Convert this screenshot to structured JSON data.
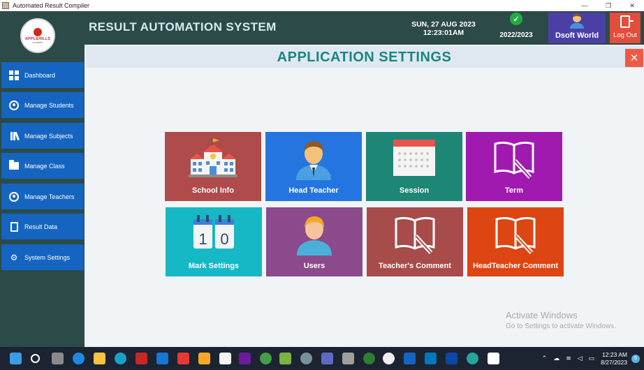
{
  "window": {
    "title": "Automated Result Compiler",
    "minimize": "—",
    "restore": "❐",
    "close": "✕"
  },
  "header": {
    "app_title": "RESULT AUTOMATION SYSTEM",
    "date": "SUN, 27 AUG 2023",
    "time": "12:23:01AM",
    "session": "2022/2023",
    "user": "Dsoft World",
    "logout": "Log Out",
    "logo_name": "APPLEHILLS",
    "logo_sub": "ACADEMY"
  },
  "sidebar": {
    "items": [
      {
        "label": "Dashboard",
        "icon": "dashboard-icon"
      },
      {
        "label": "Manage Students",
        "icon": "student-icon"
      },
      {
        "label": "Manage Subjects",
        "icon": "books-icon"
      },
      {
        "label": "Manage Class",
        "icon": "folder-icon"
      },
      {
        "label": "Manage Teachers",
        "icon": "teacher-icon"
      },
      {
        "label": "Result Data",
        "icon": "document-icon"
      },
      {
        "label": "System Settings",
        "icon": "gear-icon"
      }
    ]
  },
  "main": {
    "title": "APPLICATION SETTINGS",
    "close": "✕",
    "tiles": [
      {
        "label": "School Info",
        "icon": "school-building-icon",
        "color": "#b04b4b"
      },
      {
        "label": "Head Teacher",
        "icon": "head-teacher-icon",
        "color": "#2475e0"
      },
      {
        "label": "Session",
        "icon": "calendar-icon",
        "color": "#1e8675"
      },
      {
        "label": "Term",
        "icon": "book-pencil-icon",
        "color": "#a11ab0"
      },
      {
        "label": "Mark Settings",
        "icon": "flip-calendar-icon",
        "color": "#16b8c6"
      },
      {
        "label": "Users",
        "icon": "user-icon",
        "color": "#8b4a8c"
      },
      {
        "label": "Teacher's Comment",
        "icon": "book-pencil-icon",
        "color": "#a84b4b"
      },
      {
        "label": "HeadTeacher Comment",
        "icon": "book-pencil-icon",
        "color": "#dd4512"
      }
    ],
    "mark_digits": [
      "1",
      "0"
    ]
  },
  "watermark": {
    "line1": "Activate Windows",
    "line2": "Go to Settings to activate Windows."
  },
  "taskbar": {
    "time": "12:23 AM",
    "date": "8/27/2023"
  }
}
